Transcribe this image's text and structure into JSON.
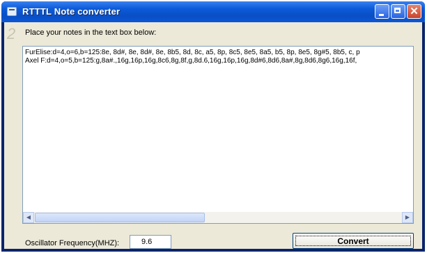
{
  "window": {
    "title": "RTTTL Note converter"
  },
  "watermark": "2",
  "prompt": "Place your notes in the text box below:",
  "notes": {
    "lines": [
      "FurElise:d=4,o=6,b=125:8e, 8d#, 8e, 8d#, 8e, 8b5, 8d, 8c, a5, 8p, 8c5, 8e5, 8a5, b5, 8p, 8e5, 8g#5, 8b5, c, p",
      "Axel F:d=4,o=5,b=125:g,8a#.,16g,16p,16g,8c6,8g,8f,g,8d.6,16g,16p,16g,8d#6,8d6,8a#,8g,8d6,8g6,16g,16f,"
    ]
  },
  "oscillator": {
    "label": "Oscillator Frequency(MHZ):",
    "value": "9.6"
  },
  "convert_label": "Convert",
  "icons": {
    "min": "minimize-icon",
    "max": "maximize-icon",
    "close": "close-icon",
    "app": "app-icon"
  }
}
